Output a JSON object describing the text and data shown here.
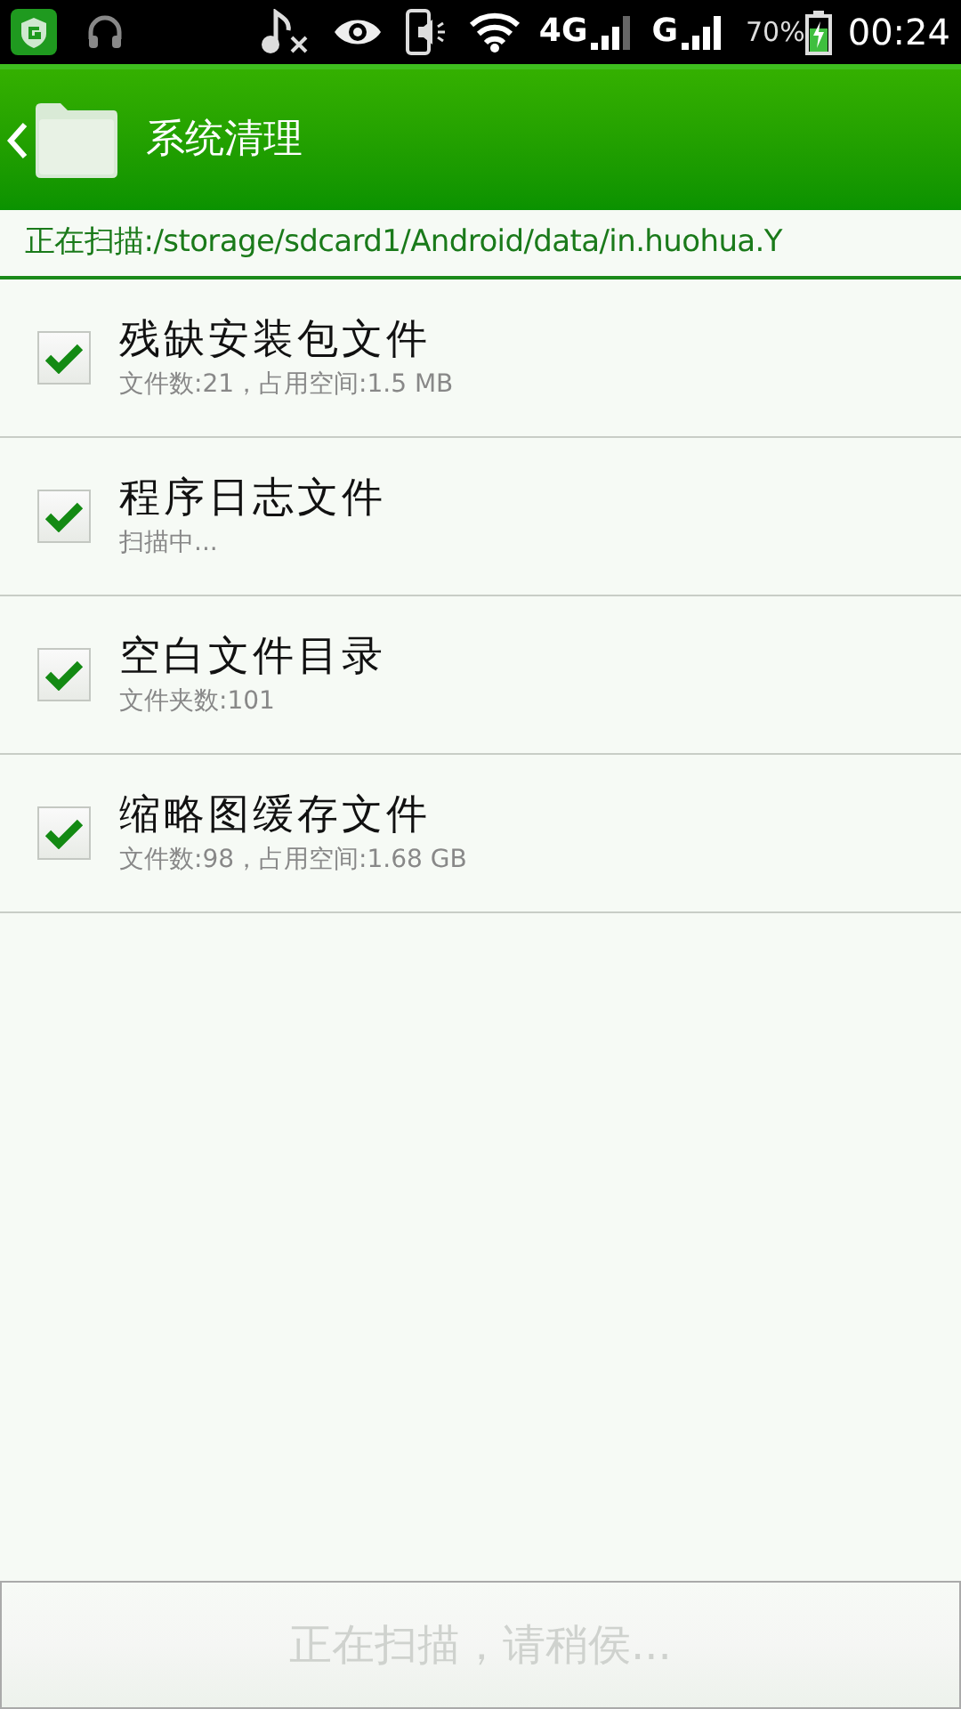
{
  "status_bar": {
    "network_4g": "4G",
    "network_g": "G",
    "battery": "70%",
    "time": "00:24"
  },
  "header": {
    "title": "系统清理"
  },
  "scan_path": "正在扫描:/storage/sdcard1/Android/data/in.huohua.Y",
  "items": [
    {
      "title": "残缺安装包文件",
      "detail": "文件数:21，占用空间:1.5 MB",
      "checked": true
    },
    {
      "title": "程序日志文件",
      "detail": "扫描中...",
      "checked": true
    },
    {
      "title": "空白文件目录",
      "detail": "文件夹数:101",
      "checked": true
    },
    {
      "title": "缩略图缓存文件",
      "detail": "文件数:98，占用空间:1.68 GB",
      "checked": true
    }
  ],
  "action_button": {
    "label": "正在扫描，请稍侯...",
    "disabled": true
  }
}
